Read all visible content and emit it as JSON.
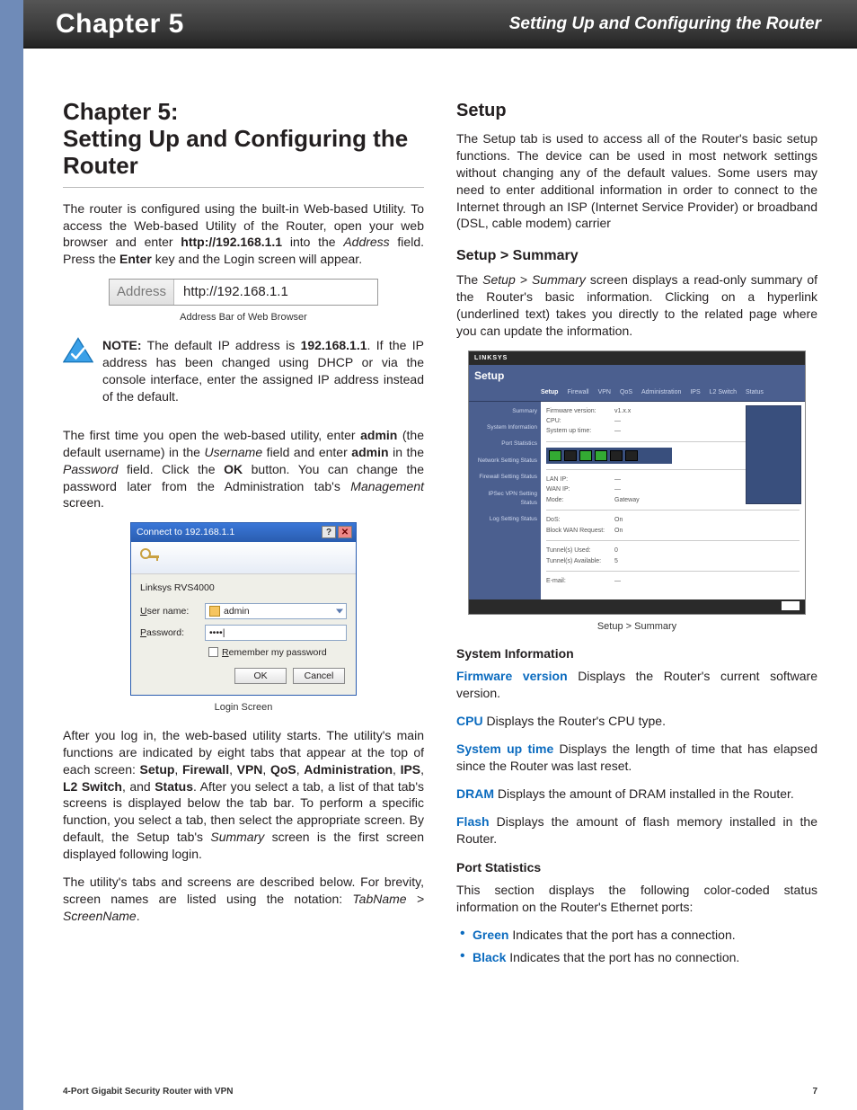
{
  "header": {
    "chapter": "Chapter 5",
    "title": "Setting Up and Configuring the Router"
  },
  "left": {
    "h1_a": "Chapter 5:",
    "h1_b": "Setting Up and Configuring the Router",
    "intro1_a": "The router is configured using the built-in Web-based Utility. To access the Web-based Utility of the Router, open your web browser and enter ",
    "intro1_b": "http://192.168.1.1",
    "intro1_c": " into the ",
    "intro1_d": "Address",
    "intro1_e": " field. Press the ",
    "intro1_f": "Enter",
    "intro1_g": " key and the Login screen will appear.",
    "addr_label": "Address",
    "addr_url": "http://192.168.1.1",
    "addr_caption": "Address Bar of Web Browser",
    "note_label": "NOTE:",
    "note_a": " The default IP address is ",
    "note_ip": "192.168.1.1",
    "note_b": ". If the IP address has been changed using DHCP or via the console interface, enter the assigned IP address instead of the default.",
    "firsttime_a": "The first time you open the web-based utility, enter ",
    "firsttime_b": "admin",
    "firsttime_c": " (the default username) in the ",
    "firsttime_d": "Username",
    "firsttime_e": " field and enter ",
    "firsttime_f": "admin",
    "firsttime_g": " in the ",
    "firsttime_h": "Password",
    "firsttime_i": " field. Click the ",
    "firsttime_j": "OK",
    "firsttime_k": " button. You can change the password later from the Administration tab's ",
    "firsttime_l": "Management",
    "firsttime_m": " screen.",
    "login": {
      "title": "Connect to 192.168.1.1",
      "realm": "Linksys RVS4000",
      "user_label": "User name:",
      "user_value": "admin",
      "pass_label": "Password:",
      "pass_value": "••••|",
      "remember_a": "R",
      "remember_b": "emember my password",
      "ok": "OK",
      "cancel": "Cancel",
      "help": "?"
    },
    "login_caption": "Login Screen",
    "after1_a": "After you log in, the web-based utility starts. The utility's main functions are indicated by eight tabs that appear at the top of each screen: ",
    "tab1": "Setup",
    "tab2": "Firewall",
    "tab3": "VPN",
    "tab4": "QoS",
    "tab5": "Administration",
    "tab6": "IPS",
    "tab7": "L2 Switch",
    "tab8": "Status",
    "after1_b": ". After you select a tab, a list of that tab's screens is displayed below the tab bar. To perform a specific function, you select a tab, then select the appropriate screen. By default, the Setup tab's ",
    "after1_c": "Summary",
    "after1_d": " screen is the first screen displayed following login.",
    "after2_a": "The utility's tabs and screens are described below. For brevity, screen names are listed using the notation: ",
    "after2_b": "TabName > ScreenName",
    "after2_c": "."
  },
  "right": {
    "setup_h": "Setup",
    "setup_p": "The Setup tab is used to access all of the Router's basic setup functions. The device can be used in most network settings without changing any of the default values. Some users may need to enter additional information in order to connect to the Internet through an ISP (Internet Service Provider) or broadband (DSL, cable modem) carrier",
    "summary_h": "Setup > Summary",
    "summary_p_a": "The ",
    "summary_p_b": "Setup > Summary",
    "summary_p_c": " screen displays a read-only summary of the Router's basic information. Clicking on a hyperlink (underlined text) takes you directly to the related page where you can update the information.",
    "mock": {
      "brand": "LINKSYS",
      "section": "Setup",
      "tabs": [
        "Setup",
        "Firewall",
        "VPN",
        "QoS",
        "Administration",
        "IPS",
        "L2 Switch",
        "Status"
      ],
      "nav": [
        "Summary",
        "System Information",
        "Port Statistics",
        "Network Setting Status",
        "Firewall Setting Status",
        "IPSec VPN Setting Status",
        "Log Setting Status"
      ]
    },
    "mock_caption": "Setup > Summary",
    "sysinfo_h": "System Information",
    "fw_t": "Firmware version",
    "fw_d": "  Displays the Router's current software version.",
    "cpu_t": "CPU",
    "cpu_d": "  Displays the Router's CPU type.",
    "up_t": "System up time",
    "up_d": "  Displays the length of time that has elapsed since the Router was last reset.",
    "dram_t": "DRAM",
    "dram_d": "  Displays the amount of DRAM installed in the Router.",
    "flash_t": "Flash",
    "flash_d": "  Displays the amount of flash memory installed in the Router.",
    "portstat_h": "Port Statistics",
    "portstat_p": "This section displays the following color-coded status information on the Router's Ethernet ports:",
    "green_t": "Green",
    "green_d": "  Indicates that the port has a connection.",
    "black_t": "Black",
    "black_d": "  Indicates that the port has no connection."
  },
  "footer": {
    "left": "4-Port Gigabit Security Router with VPN",
    "right": "7"
  }
}
